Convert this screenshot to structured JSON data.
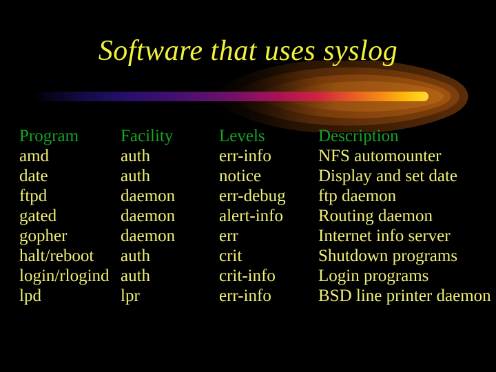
{
  "slide": {
    "title": "Software that uses syslog",
    "title_color": "#F2F23C",
    "background_color": "#000000",
    "header_color": "#16A326",
    "body_color": "#F0F078"
  },
  "decoration": {
    "name": "comet-gradient-bar",
    "bar_colors": [
      "#05030F",
      "#120A45",
      "#26106B",
      "#4A1070",
      "#7E1161",
      "#B81350",
      "#DE3A34",
      "#F07818",
      "#FBB40A",
      "#FFD42A"
    ],
    "halo_colors": [
      "#2A1403",
      "#4A2406",
      "#6E360A",
      "#8E4910",
      "#A85A14"
    ]
  },
  "table": {
    "columns": [
      "Program",
      "Facility",
      "Levels",
      "Description"
    ],
    "rows": [
      [
        "amd",
        "auth",
        "err-info",
        "NFS automounter"
      ],
      [
        "date",
        "auth",
        "notice",
        "Display and set date"
      ],
      [
        "ftpd",
        "daemon",
        "err-debug",
        "ftp daemon"
      ],
      [
        "gated",
        "daemon",
        "alert-info",
        "Routing daemon"
      ],
      [
        "gopher",
        "daemon",
        "err",
        "Internet info server"
      ],
      [
        "halt/reboot",
        "auth",
        "crit",
        "Shutdown programs"
      ],
      [
        "login/rlogind",
        "auth",
        "crit-info",
        "Login programs"
      ],
      [
        "lpd",
        "lpr",
        "err-info",
        "BSD line printer daemon"
      ]
    ]
  }
}
